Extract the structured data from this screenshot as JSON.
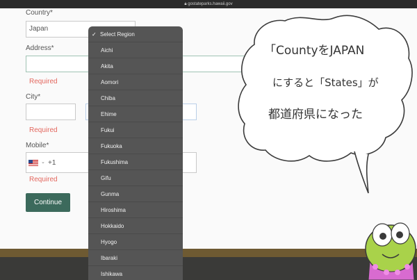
{
  "browser": {
    "url": "gostateparks.hawaii.gov"
  },
  "form": {
    "country_label": "Country*",
    "country_value": "Japan",
    "address_label": "Address*",
    "address_error": "Required",
    "city_label": "City*",
    "city_error": "Required",
    "mobile_label": "Mobile*",
    "mobile_dial_code": "+1",
    "mobile_error": "Required",
    "continue_label": "Continue"
  },
  "region_dropdown": {
    "selected": "Select Region",
    "options": [
      "Aichi",
      "Akita",
      "Aomori",
      "Chiba",
      "Ehime",
      "Fukui",
      "Fukuoka",
      "Fukushima",
      "Gifu",
      "Gunma",
      "Hiroshima",
      "Hokkaido",
      "Hyogo",
      "Ibaraki",
      "Ishikawa"
    ]
  },
  "speech_bubble": {
    "line1": "「CountyをJAPAN",
    "line2": "にすると「States」が",
    "line3": "都道府県になった"
  },
  "colors": {
    "button": "#3c6a5c",
    "error": "#e3675e",
    "dropdown": "#555555",
    "footer_band": "#6e5a32",
    "mascot_green": "#a9d24a"
  }
}
